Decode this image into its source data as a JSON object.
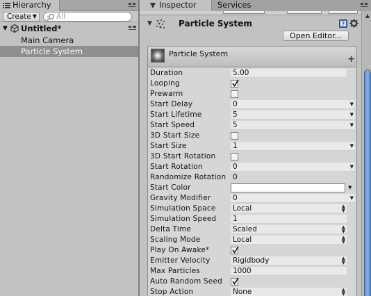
{
  "hierarchy": {
    "tab_label": "Hierarchy",
    "create_label": "Create",
    "search_placeholder": "All",
    "scene_name": "Untitled*",
    "items": [
      {
        "label": "Main Camera"
      },
      {
        "label": "Particle System"
      }
    ]
  },
  "inspector": {
    "tab_label": "Inspector",
    "services_label": "Services",
    "component_title": "Particle System",
    "open_editor_label": "Open Editor...",
    "module_title": "Particle System",
    "plus_label": "+",
    "properties": [
      {
        "label": "Duration",
        "value": "5.00",
        "kind": "number"
      },
      {
        "label": "Looping",
        "value": true,
        "kind": "checkbox"
      },
      {
        "label": "Prewarm",
        "value": false,
        "kind": "checkbox"
      },
      {
        "label": "Start Delay",
        "value": "0",
        "kind": "dropdown"
      },
      {
        "label": "Start Lifetime",
        "value": "5",
        "kind": "dropdown"
      },
      {
        "label": "Start Speed",
        "value": "5",
        "kind": "dropdown"
      },
      {
        "label": "3D Start Size",
        "value": false,
        "kind": "checkbox"
      },
      {
        "label": "Start Size",
        "value": "1",
        "kind": "dropdown"
      },
      {
        "label": "3D Start Rotation",
        "value": false,
        "kind": "checkbox"
      },
      {
        "label": "Start Rotation",
        "value": "0",
        "kind": "dropdown"
      },
      {
        "label": "Randomize Rotation",
        "value": "0",
        "kind": "number"
      },
      {
        "label": "Start Color",
        "value": "#ffffff",
        "kind": "color"
      },
      {
        "label": "Gravity Modifier",
        "value": "0",
        "kind": "dropdown"
      },
      {
        "label": "Simulation Space",
        "value": "Local",
        "kind": "popup"
      },
      {
        "label": "Simulation Speed",
        "value": "1",
        "kind": "number"
      },
      {
        "label": "Delta Time",
        "value": "Scaled",
        "kind": "popup"
      },
      {
        "label": "Scaling Mode",
        "value": "Local",
        "kind": "popup"
      },
      {
        "label": "Play On Awake*",
        "value": true,
        "kind": "checkbox"
      },
      {
        "label": "Emitter Velocity",
        "value": "Rigidbody",
        "kind": "popup"
      },
      {
        "label": "Max Particles",
        "value": "1000",
        "kind": "number"
      },
      {
        "label": "Auto Random Seed",
        "value": true,
        "kind": "checkbox"
      },
      {
        "label": "Stop Action",
        "value": "None",
        "kind": "popup"
      }
    ]
  },
  "colors": {
    "selection": "#8f8f8f",
    "panel": "#c2c2c2",
    "scroll_thumb": "#6f9ad3"
  },
  "icons": [
    "hierarchy-icon",
    "panel-menu-icon",
    "search-icon",
    "unity-scene-icon",
    "inspector-icon",
    "particle-system-icon",
    "help-icon",
    "gear-icon",
    "checkmark-icon",
    "dropdown-arrow-icon"
  ]
}
